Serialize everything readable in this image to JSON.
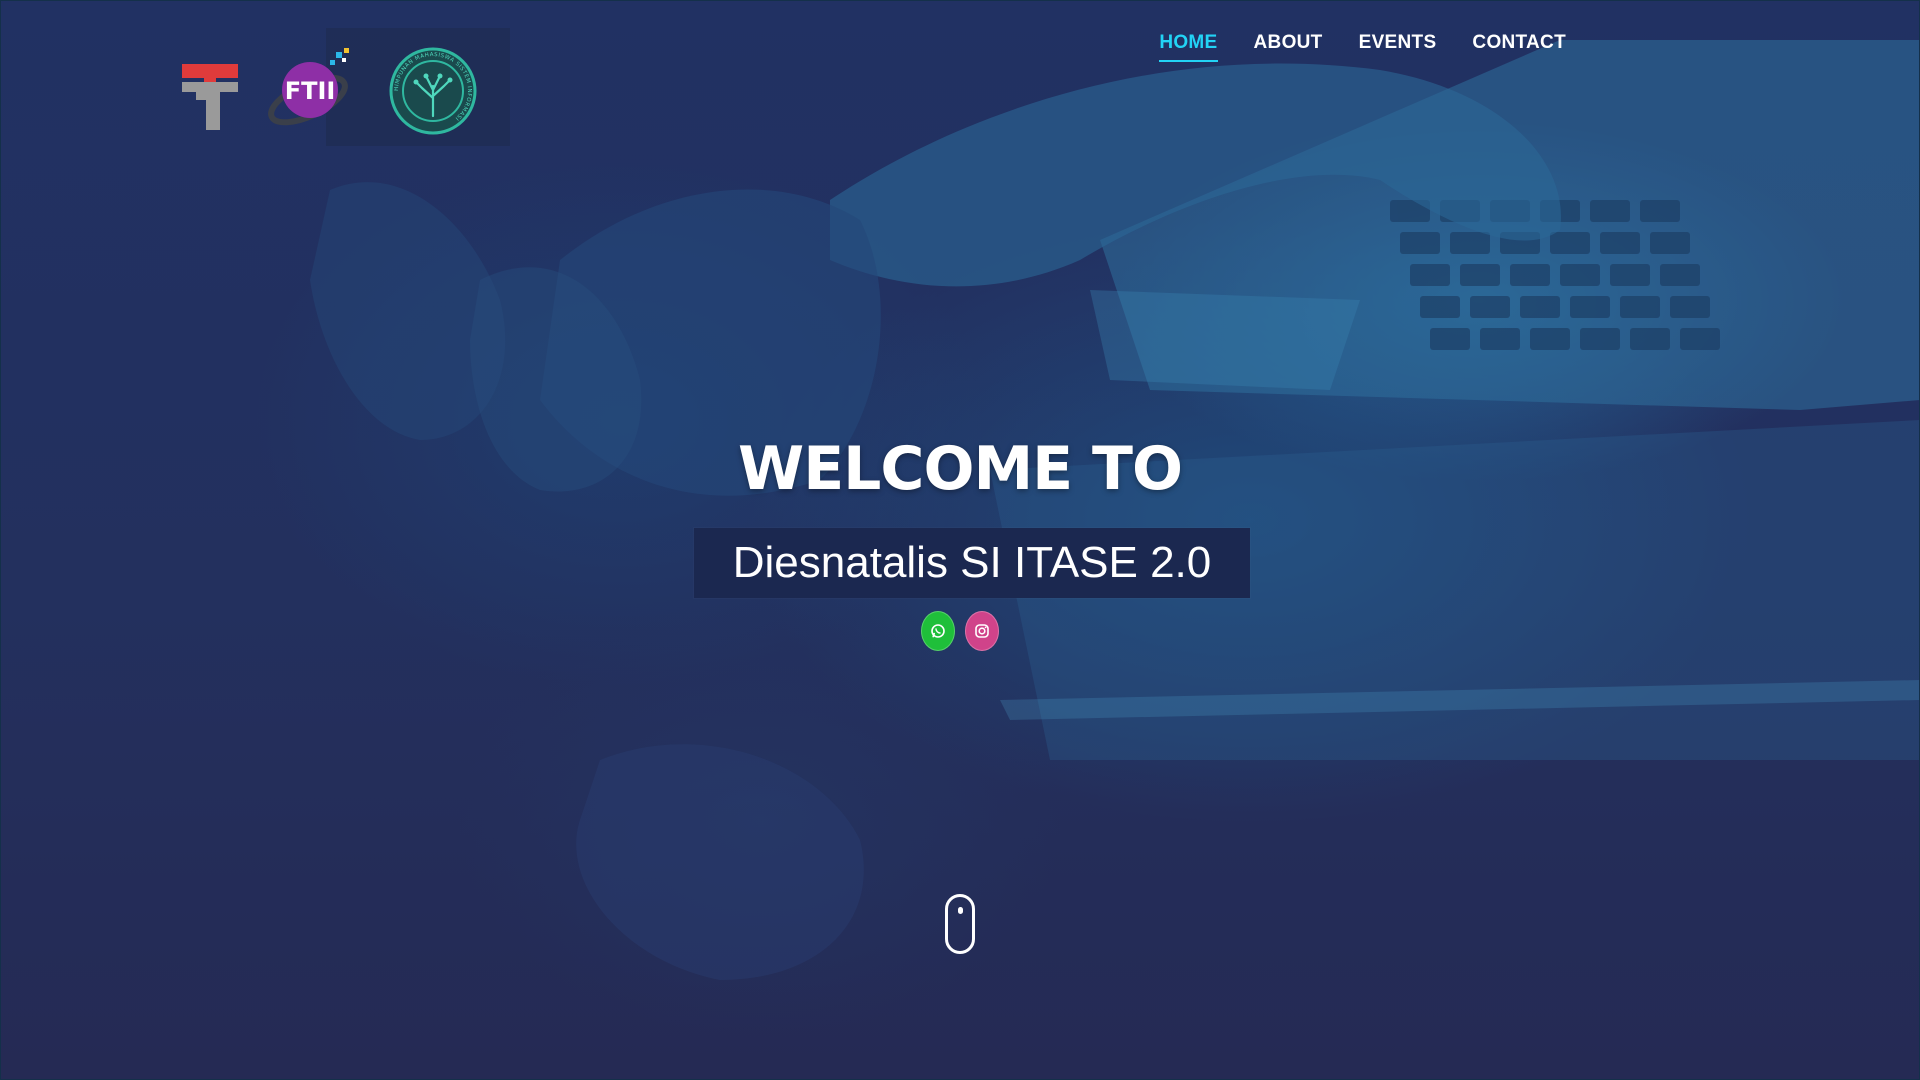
{
  "header": {
    "logos": [
      {
        "name": "institution-logo",
        "icon": "t-logo-icon"
      },
      {
        "name": "faculty-logo",
        "icon": "ftii-logo-icon",
        "text": "FTII"
      },
      {
        "name": "student-association-seal",
        "icon": "tree-seal-icon",
        "seal_text": "HIMPUNAN MAHASISWA SISTEM INFORMASI"
      }
    ]
  },
  "nav": {
    "items": [
      {
        "label": "HOME",
        "active": true
      },
      {
        "label": "ABOUT",
        "active": false
      },
      {
        "label": "EVENTS",
        "active": false
      },
      {
        "label": "CONTACT",
        "active": false
      }
    ],
    "active_color": "#22d3f5"
  },
  "hero": {
    "heading": "WELCOME TO",
    "subtitle": "Diesnatalis SI ITASE 2.0"
  },
  "social": [
    {
      "name": "whatsapp",
      "icon": "whatsapp-icon",
      "color": "#1fbf3a"
    },
    {
      "name": "instagram",
      "icon": "instagram-icon",
      "color": "#d0438a"
    }
  ],
  "scroll_indicator": {
    "icon": "mouse-scroll-icon"
  },
  "colors": {
    "background": "#23305e",
    "overlay_tint": "#1e4f86",
    "text": "#ffffff"
  }
}
